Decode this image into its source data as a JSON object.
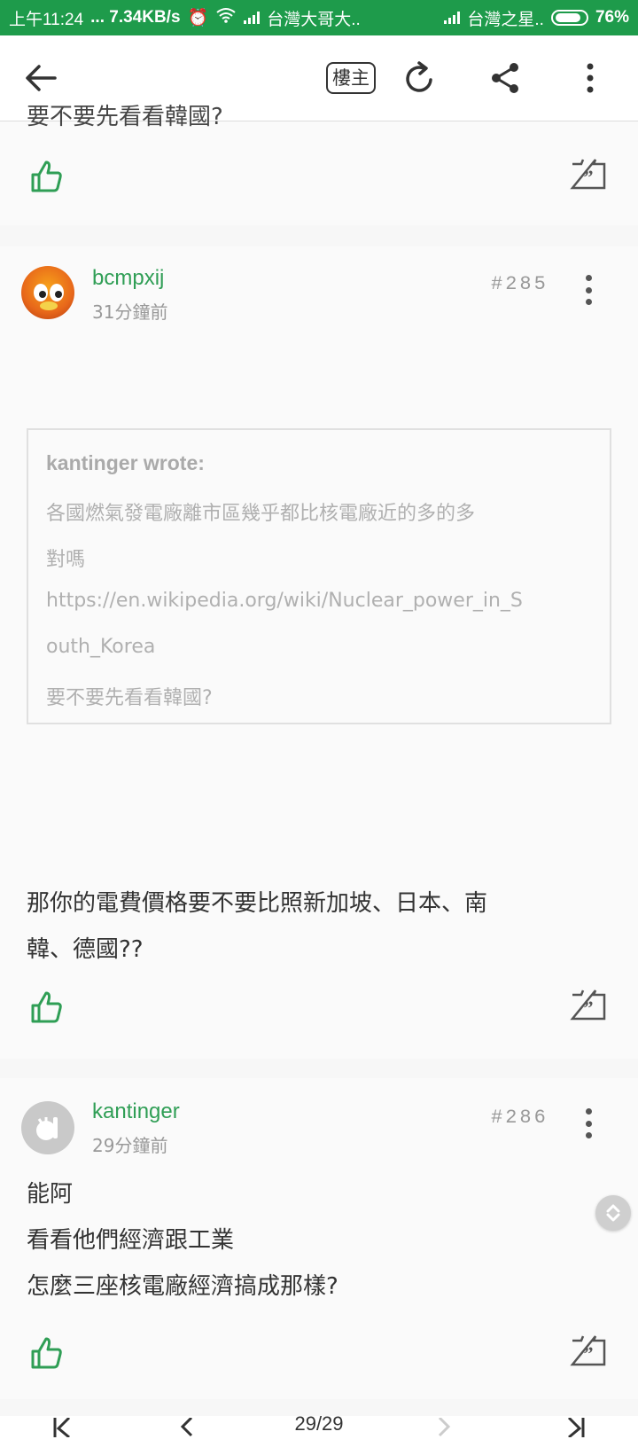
{
  "status_bar": {
    "time": "上午11:24",
    "network_speed": "... 7.34KB/s",
    "carrier1": "台灣大哥大..",
    "carrier2": "台灣之星..",
    "battery": "76%"
  },
  "toolbar": {
    "owner_label": "樓主"
  },
  "prev_post": {
    "cut_text": "要不要先看看韓國?"
  },
  "posts": [
    {
      "username": "bcmpxij",
      "time": "31分鐘前",
      "floor": "#285",
      "quote": {
        "author": "kantinger wrote:",
        "lines": [
          "各國燃氣發電廠離市區幾乎都比核電廠近的多的多",
          "對嗎",
          "https://en.wikipedia.org/wiki/Nuclear_power_in_S",
          "outh_Korea",
          "要不要先看看韓國?"
        ]
      },
      "lines": [
        "那你的電費價格要不要比照新加坡、日本、南",
        "韓、德國??"
      ]
    },
    {
      "username": "kantinger",
      "time": "29分鐘前",
      "floor": "#286",
      "lines": [
        "能阿",
        "看看他們經濟跟工業",
        "怎麼三座核電廠經濟搞成那樣?"
      ]
    }
  ],
  "bottom_bar": {
    "page": "29/29"
  },
  "colors": {
    "status_bar": "#1e9b4b",
    "accent_green": "#2f9e55"
  }
}
